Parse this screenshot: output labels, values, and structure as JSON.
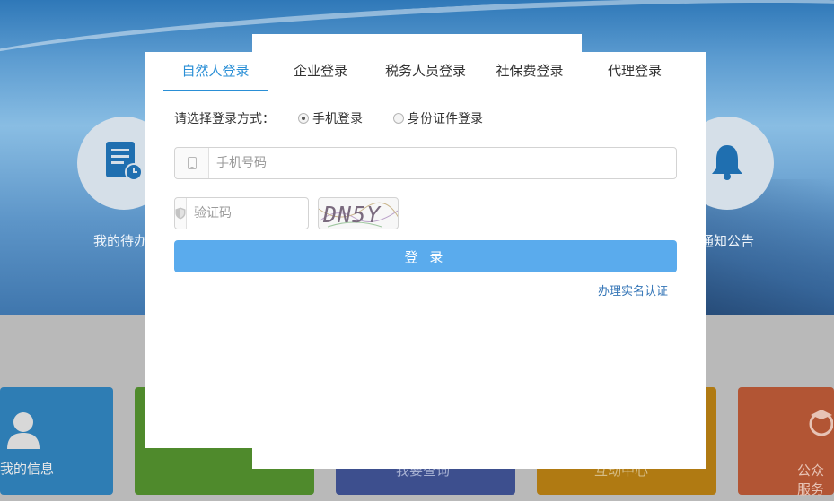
{
  "background": {
    "left_feature_label": "我的待办",
    "right_feature_label": "通知公告",
    "tiles": [
      {
        "label": "我的信息",
        "color": "#2e7db4"
      },
      {
        "label": "",
        "color": "#4f8a2c"
      },
      {
        "label": "我要查询",
        "color": "#3d4f8e"
      },
      {
        "label": "互动中心",
        "color": "#b07a12"
      },
      {
        "label": "公众服务",
        "color": "#b25534"
      }
    ]
  },
  "login": {
    "tabs": [
      {
        "label": "自然人登录",
        "active": true
      },
      {
        "label": "企业登录",
        "active": false
      },
      {
        "label": "税务人员登录",
        "active": false
      },
      {
        "label": "社保费登录",
        "active": false
      },
      {
        "label": "代理登录",
        "active": false
      }
    ],
    "method_label": "请选择登录方式：",
    "methods": [
      {
        "label": "手机登录",
        "checked": true
      },
      {
        "label": "身份证件登录",
        "checked": false
      }
    ],
    "phone_placeholder": "手机号码",
    "phone_icon": "mobile-icon",
    "code_placeholder": "验证码",
    "code_icon": "shield-icon",
    "captcha_text": "DN5Y",
    "submit_label": "登 录",
    "verify_link": "办理实名认证",
    "accent_color": "#2a8fd6",
    "button_color": "#5aabed"
  }
}
